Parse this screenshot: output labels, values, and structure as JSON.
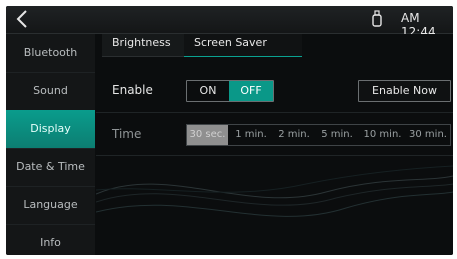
{
  "header": {
    "clock": "AM 12:44",
    "icons": {
      "back": "chevron-left-icon",
      "usb": "usb-icon"
    }
  },
  "sidebar": {
    "items": [
      {
        "label": "Bluetooth",
        "active": false
      },
      {
        "label": "Sound",
        "active": false
      },
      {
        "label": "Display",
        "active": true
      },
      {
        "label": "Date & Time",
        "active": false
      },
      {
        "label": "Language",
        "active": false
      },
      {
        "label": "Info",
        "active": false
      }
    ]
  },
  "tabs": [
    {
      "label": "Brightness"
    },
    {
      "label": "Screen Saver",
      "active": true
    }
  ],
  "enable": {
    "label": "Enable",
    "on_label": "ON",
    "off_label": "OFF",
    "selected": "OFF",
    "enable_now_label": "Enable Now"
  },
  "time": {
    "label": "Time",
    "options": [
      "30 sec.",
      "1 min.",
      "2 min.",
      "5 min.",
      "10 min.",
      "30 min."
    ],
    "selected": "30 sec."
  },
  "colors": {
    "accent": "#0a9888",
    "background": "#0b0d0e",
    "sidebar": "#141617"
  }
}
